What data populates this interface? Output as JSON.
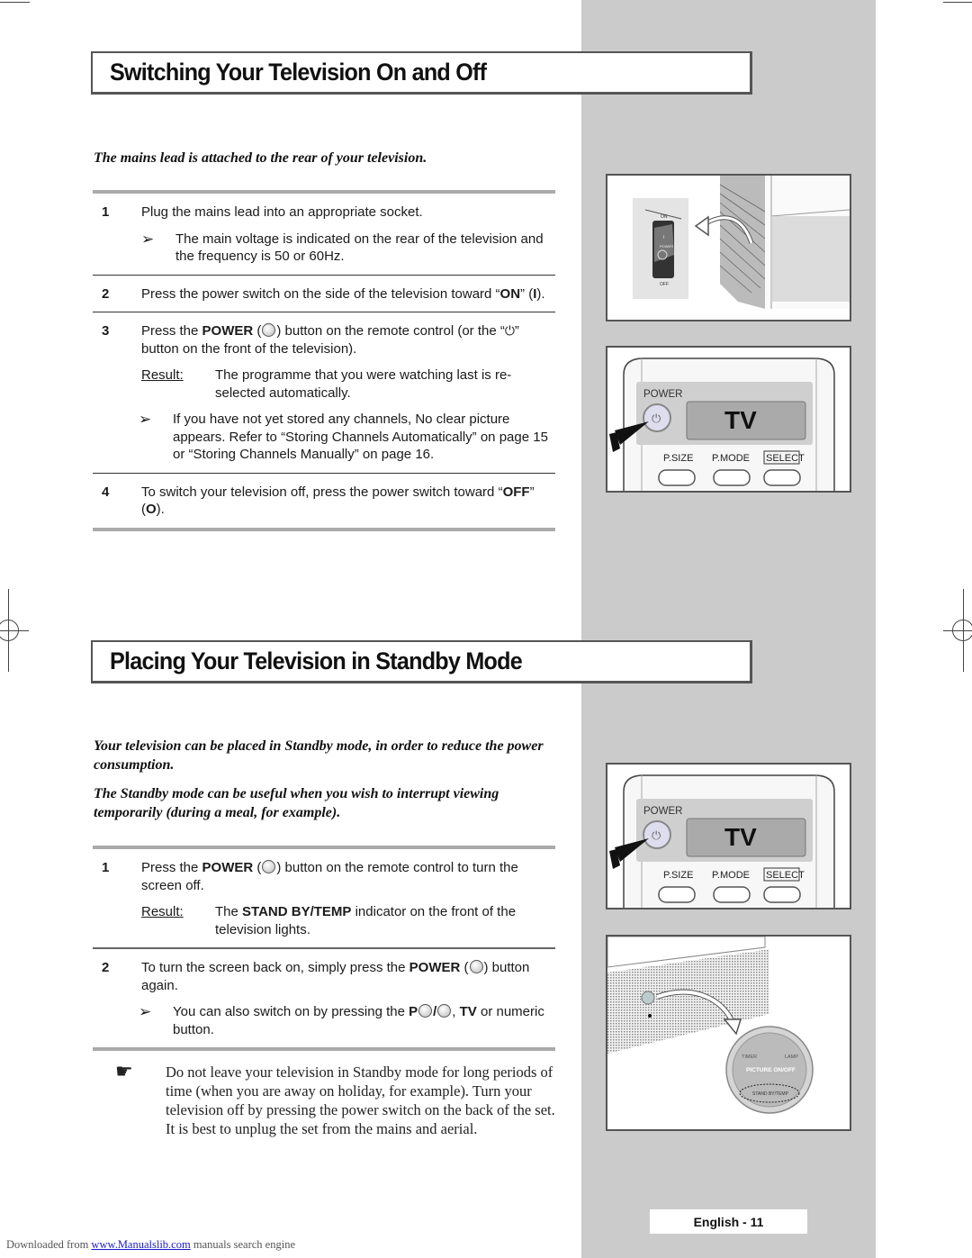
{
  "section1": {
    "title": "Switching Your Television On and Off",
    "intro": "The mains lead is attached to the rear of your television.",
    "steps": [
      {
        "num": "1",
        "text": "Plug the mains lead into an appropriate socket.",
        "note": "The main voltage is indicated on the rear of the television and the frequency is 50 or 60Hz."
      },
      {
        "num": "2",
        "text_before": "Press the power switch on the side of the television toward “",
        "bold": "ON",
        "text_mid": "” (",
        "bold2": "I",
        "text_after": ")."
      },
      {
        "num": "3",
        "text_before": "Press the ",
        "bold": "POWER",
        "text_after": ") button on the remote control (or the “",
        "text_end": "” button on the front of the television).",
        "result_label": "Result",
        "result_text": "The programme that you were watching last is re-selected automatically.",
        "note": "If you have not yet stored any channels, No clear picture appears. Refer to “Storing Channels Automatically” on page 15 or “Storing Channels Manually” on page 16."
      },
      {
        "num": "4",
        "text_before": "To switch your television off, press the power switch toward “",
        "bold": "OFF",
        "text_mid": "” (",
        "bold2": "O",
        "text_after": ")."
      }
    ],
    "figure_switch": {
      "switch_on_label": "ON",
      "switch_off_label": "OFF",
      "switch_power_label": "POWER",
      "switch_i": "I"
    },
    "figure_remote": {
      "power_label": "POWER",
      "display_text": "TV",
      "buttons": [
        "P.SIZE",
        "P.MODE",
        "SELECT"
      ]
    }
  },
  "section2": {
    "title": "Placing Your Television in Standby Mode",
    "intro": [
      "Your television can be placed in Standby mode, in order to reduce the power consumption.",
      "The Standby mode can be useful when you wish to interrupt viewing temporarily (during a meal, for example)."
    ],
    "steps": [
      {
        "num": "1",
        "text_before": "Press the ",
        "bold": "POWER",
        "text_after": ") button on the remote control to turn the screen off.",
        "result_label": "Result",
        "result_before": "The ",
        "result_bold": "STAND BY/TEMP",
        "result_after": " indicator on the front of the television lights."
      },
      {
        "num": "2",
        "text_before": "To turn the screen back on, simply press the ",
        "bold": "POWER",
        "text_after": ") button again.",
        "note_before": "You can also switch on by pressing the ",
        "note_bold_p": "P",
        "note_slash": "/",
        "note_mid": ", ",
        "note_bold_tv": "TV",
        "note_after": " or numeric button."
      }
    ],
    "caution": "Do not leave your television in Standby mode for long periods of time (when you are away on holiday, for example). Turn your television off by pressing the power switch on the back of the set. It is best to unplug the set from the mains and aerial.",
    "figure_remote": {
      "power_label": "POWER",
      "display_text": "TV",
      "buttons": [
        "P.SIZE",
        "P.MODE",
        "SELECT"
      ]
    },
    "figure_panel": {
      "timer": "TIMER",
      "lamp": "LAMP",
      "picture": "PICTURE ON/OFF",
      "standby": "STAND BY/TEMP"
    }
  },
  "icons": {
    "note_arrow": "➢",
    "hand": "☛",
    "standby": "⏻"
  },
  "page_badge": "English - 11",
  "footer": {
    "before": "Downloaded from ",
    "link": "www.Manualslib.com",
    "after": " manuals search engine"
  }
}
